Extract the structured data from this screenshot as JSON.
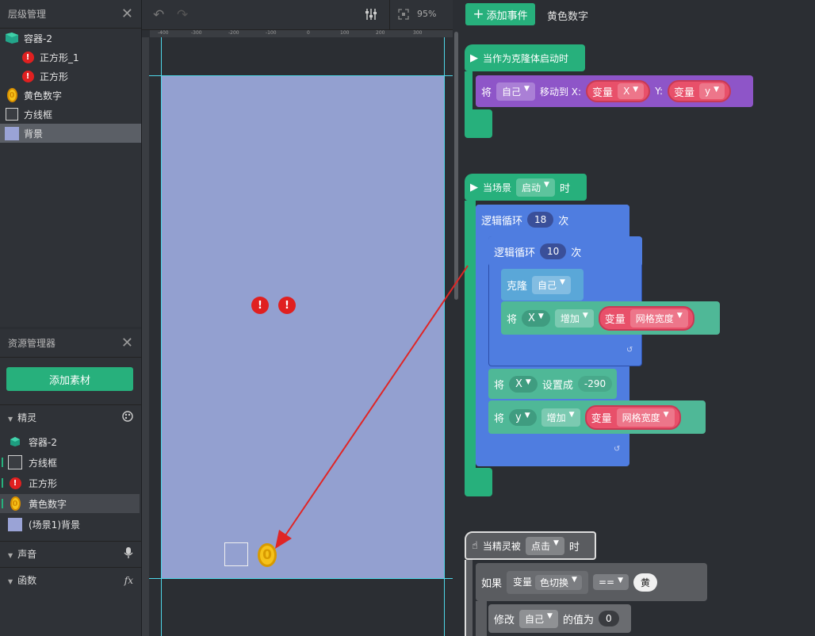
{
  "layer_panel": {
    "title": "层级管理",
    "items": [
      {
        "label": "容器-2",
        "icon": "container-icon"
      },
      {
        "label": "正方形_1",
        "icon": "red-exclaim-icon"
      },
      {
        "label": "正方形",
        "icon": "red-exclaim-icon"
      },
      {
        "label": "黄色数字",
        "icon": "coin-icon"
      },
      {
        "label": "方线框",
        "icon": "frame-icon"
      },
      {
        "label": "背景",
        "icon": "background-icon"
      }
    ]
  },
  "resource_panel": {
    "title": "资源管理器",
    "add_button": "添加素材",
    "sprites_label": "精灵",
    "sprites": [
      {
        "label": "容器-2"
      },
      {
        "label": "方线框"
      },
      {
        "label": "正方形"
      },
      {
        "label": "黄色数字"
      },
      {
        "label": "(场景1)背景"
      }
    ],
    "sound_label": "声音",
    "function_label": "函数",
    "fx": "fx"
  },
  "toolbar": {
    "zoom": "95%"
  },
  "ruler_top": [
    "-400",
    "-300",
    "-200",
    "-100",
    "0",
    "100",
    "200",
    "300"
  ],
  "script": {
    "add_event": "添加事件",
    "object_name": "黄色数字",
    "b1_hat": "当作为克隆体启动时",
    "b1_move": {
      "will": "将",
      "self": "自己",
      "moveto": "移动到 X:",
      "var": "变量",
      "x": "X",
      "ylab": "Y:",
      "var2": "变量",
      "y": "y"
    },
    "b2_hat": {
      "pre": "当场景",
      "dd": "启动",
      "post": "时"
    },
    "loop1": {
      "label": "逻辑循环",
      "count": "18",
      "times": "次"
    },
    "loop2": {
      "label": "逻辑循环",
      "count": "10",
      "times": "次"
    },
    "clone": {
      "label": "克隆",
      "dd": "自己"
    },
    "inc_x": {
      "will": "将",
      "var": "X",
      "op": "增加",
      "vlabel": "变量",
      "vname": "网格宽度"
    },
    "set_x": {
      "will": "将",
      "var": "X",
      "op": "设置成",
      "value": "-290"
    },
    "inc_y": {
      "will": "将",
      "var": "y",
      "op": "增加",
      "vlabel": "变量",
      "vname": "网格宽度"
    },
    "b3_hat": {
      "pre": "当精灵被",
      "dd": "点击",
      "post": "时"
    },
    "if": {
      "label": "如果",
      "var": "变量",
      "vname": "色切换",
      "op": "==",
      "value": "黄"
    },
    "modify": {
      "label": "修改",
      "dd": "自己",
      "post": "的值为",
      "value": "0"
    }
  }
}
